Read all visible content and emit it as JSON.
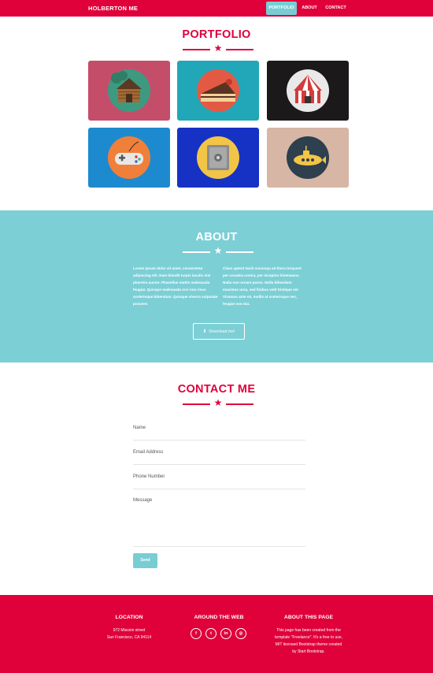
{
  "nav": {
    "brand": "HOLBERTON ME",
    "links": [
      {
        "label": "PORTFOLIO",
        "active": true
      },
      {
        "label": "ABOUT",
        "active": false
      },
      {
        "label": "CONTACT",
        "active": false
      }
    ]
  },
  "portfolio": {
    "title": "PORTFOLIO",
    "items": [
      {
        "name": "cabin",
        "bg": "#c44e6a",
        "circle": "#3d9a80"
      },
      {
        "name": "cake",
        "bg": "#22a7b8",
        "circle": "#e35a44"
      },
      {
        "name": "circus",
        "bg": "#1b1919",
        "circle": "#e9e9e9"
      },
      {
        "name": "game-controller",
        "bg": "#1d8acf",
        "circle": "#f07f3a"
      },
      {
        "name": "safe",
        "bg": "#1632c5",
        "circle": "#f3c546"
      },
      {
        "name": "submarine",
        "bg": "#d7b6a5",
        "circle": "#2e3f4d"
      }
    ]
  },
  "about": {
    "title": "ABOUT",
    "col1": "Lorem ipsum dolor sit amet, consectetur adipiscing elit. Nam blandit turpis iaculis nisi pharetra auctor. Phasellus mattis malesuada feugiat. Quisque malesuada orci non risus scelerisque bibendum. Quisque viverra vulputate posuere.",
    "col2": "Class aptent taciti sociosqu ad litora torquent per conubia nostra, per inceptos himenaeos. Nulla non ornare purus. Nulla bibendum maximus urna, sed finibus velit tristique vel. Vivamus ante mi, mollis at scelerisque nec, feugiat non dui.",
    "button": "Download me!"
  },
  "contact": {
    "title": "CONTACT ME",
    "fields": {
      "name": "Name",
      "email": "Email Address",
      "phone": "Phone Number",
      "message": "Message"
    },
    "send": "Send"
  },
  "footer": {
    "location": {
      "title": "LOCATION",
      "line1": "972 Mission street",
      "line2": "San Francisco, CA 94114"
    },
    "web": {
      "title": "AROUND THE WEB",
      "icons": [
        "f",
        "t",
        "in",
        "◎"
      ]
    },
    "about": {
      "title": "ABOUT THIS PAGE",
      "line1": "This page has been created from the",
      "line2": "template \"Freelance\". It's a free to use,",
      "line3": "MIT licensed Bootstrap theme created",
      "line4_pre": "by ",
      "link": "Start Bootstrap",
      "line4_post": "."
    }
  },
  "colors": {
    "primary": "#e0003a",
    "accent": "#78cdd4",
    "about_bg": "#7ccfd5"
  }
}
